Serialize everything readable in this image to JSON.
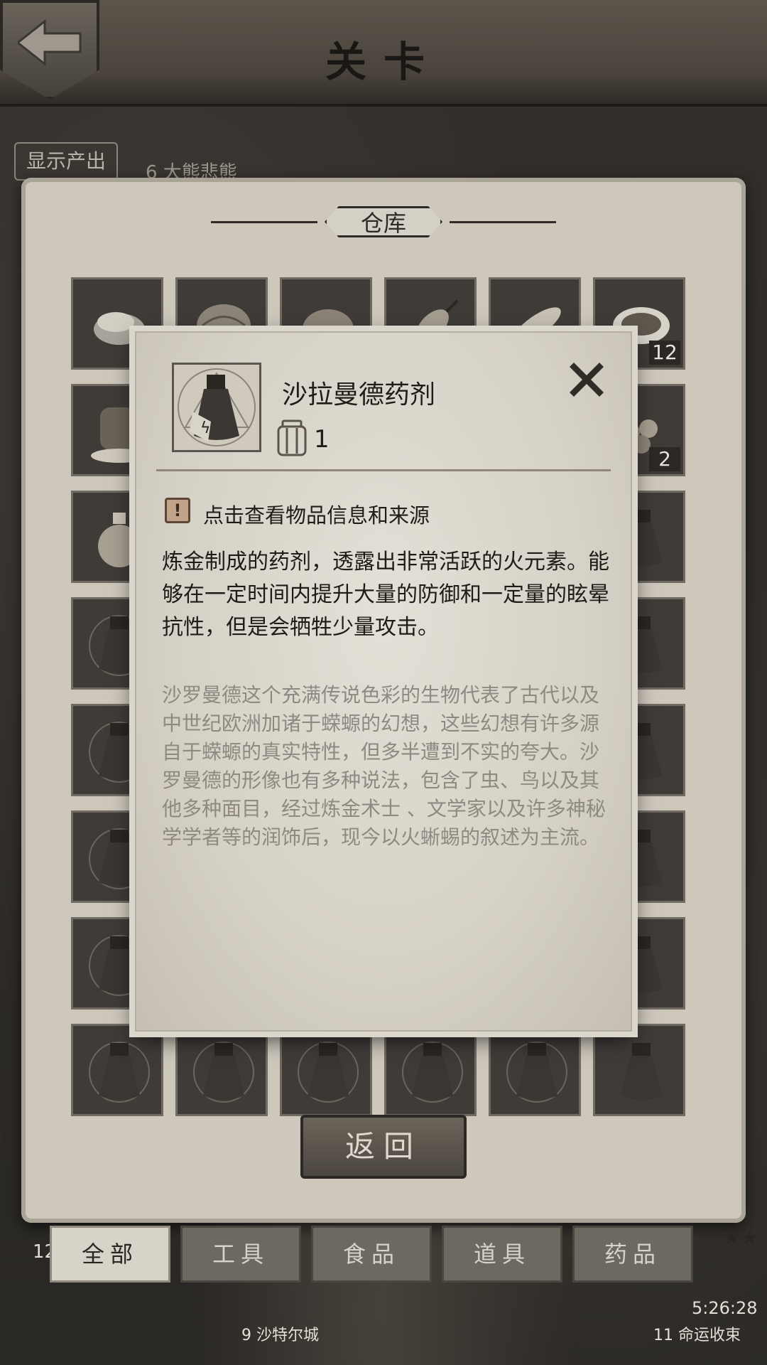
{
  "header": {
    "title": "关卡"
  },
  "map": {
    "show_output_label": "显示产出",
    "level_top": "6  大熊悲熊",
    "level_bottom_left": "12",
    "level_bottom_middle": "9  沙特尔城",
    "level_bottom_right": "11  命运收束",
    "timer": "5:26:28",
    "stars": "★★"
  },
  "warehouse": {
    "title": "仓库",
    "slot_counts": {
      "row1_col6": "12",
      "row2_col6": "2"
    },
    "return_label": "返回"
  },
  "filters": [
    {
      "label": "全部",
      "active": true
    },
    {
      "label": "工具",
      "active": false
    },
    {
      "label": "食品",
      "active": false
    },
    {
      "label": "道具",
      "active": false
    },
    {
      "label": "药品",
      "active": false
    }
  ],
  "detail": {
    "name": "沙拉曼德药剂",
    "quantity": "1",
    "hint_icon": "!",
    "hint": "点击查看物品信息和来源",
    "description": "炼金制成的药剂，透露出非常活跃的火元素。能够在一定时间内提升大量的防御和一定量的眩晕抗性，但是会牺牲少量攻击。",
    "lore": "沙罗曼德这个充满传说色彩的生物代表了古代以及中世纪欧洲加诸于蝾螈的幻想，这些幻想有许多源自于蝾螈的真实特性，但多半遭到不实的夸大。沙罗曼德的形像也有多种说法，包含了虫、鸟以及其他多种面目，经过炼金术士 、文学家以及许多神秘学学者等的润饰后，现今以火蜥蜴的叙述为主流。"
  }
}
